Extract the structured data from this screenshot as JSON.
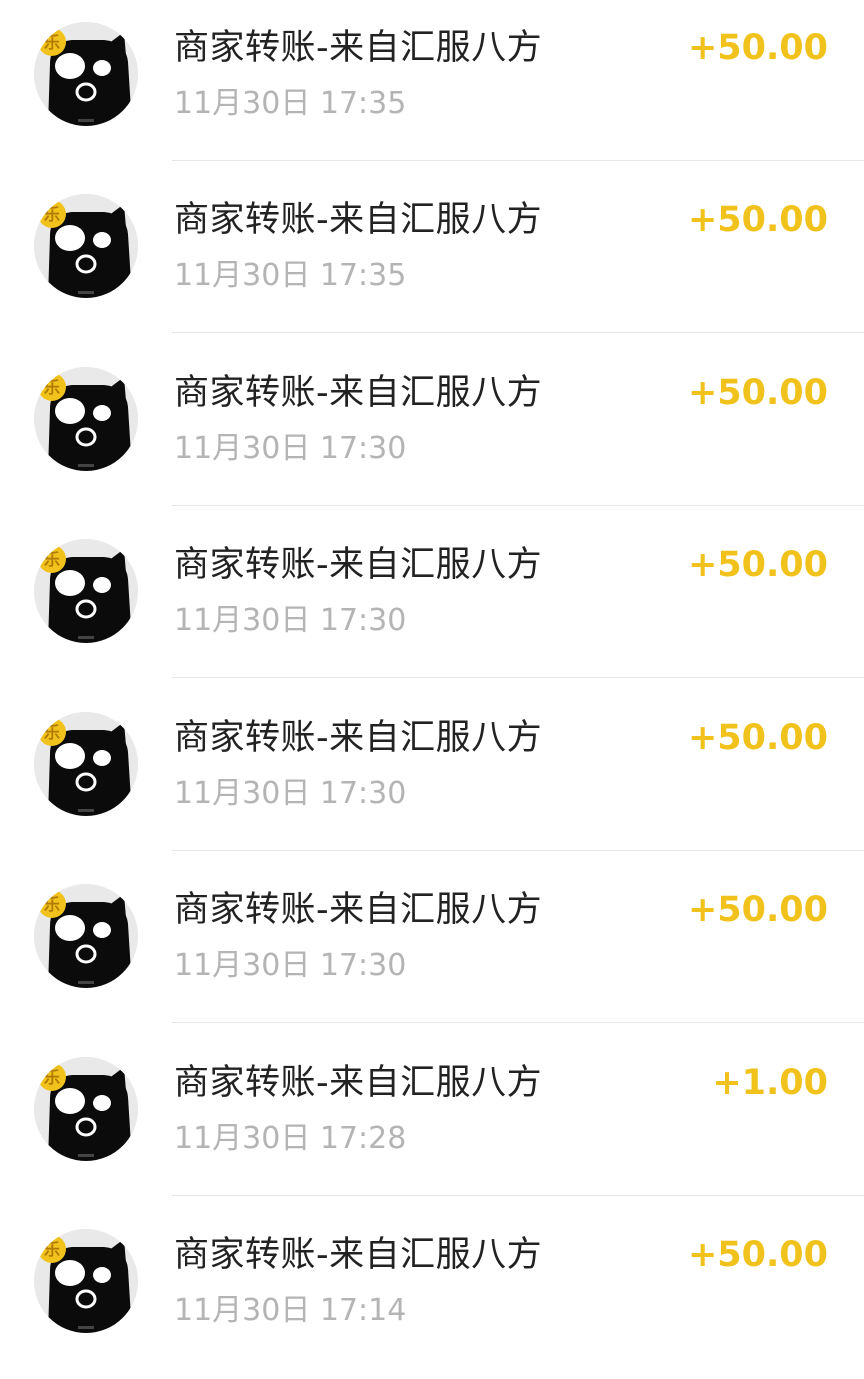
{
  "theme": {
    "amount_color": "#f1c21b",
    "title_color": "#222222",
    "time_color": "#b4b4b4"
  },
  "avatar": {
    "icon": "black-cat-mascot-avatar",
    "badge_text": "乐",
    "badge_color": "#f1c21b"
  },
  "transactions": [
    {
      "title": "商家转账-来自汇服八方",
      "time": "11月30日 17:35",
      "amount": "+50.00"
    },
    {
      "title": "商家转账-来自汇服八方",
      "time": "11月30日 17:35",
      "amount": "+50.00"
    },
    {
      "title": "商家转账-来自汇服八方",
      "time": "11月30日 17:30",
      "amount": "+50.00"
    },
    {
      "title": "商家转账-来自汇服八方",
      "time": "11月30日 17:30",
      "amount": "+50.00"
    },
    {
      "title": "商家转账-来自汇服八方",
      "time": "11月30日 17:30",
      "amount": "+50.00"
    },
    {
      "title": "商家转账-来自汇服八方",
      "time": "11月30日 17:30",
      "amount": "+50.00"
    },
    {
      "title": "商家转账-来自汇服八方",
      "time": "11月30日 17:28",
      "amount": "+1.00"
    },
    {
      "title": "商家转账-来自汇服八方",
      "time": "11月30日 17:14",
      "amount": "+50.00"
    }
  ]
}
